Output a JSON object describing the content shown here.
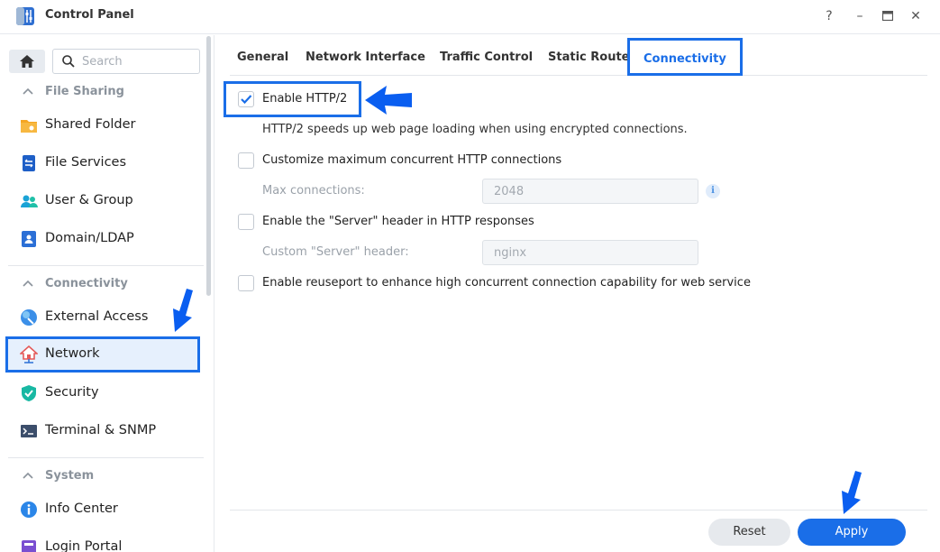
{
  "window": {
    "title": "Control Panel",
    "controls": [
      "?",
      "–",
      "□",
      "✕"
    ]
  },
  "sidebar": {
    "search_placeholder": "Search",
    "sections": [
      {
        "label": "File Sharing",
        "items": [
          "Shared Folder",
          "File Services",
          "User & Group",
          "Domain/LDAP"
        ]
      },
      {
        "label": "Connectivity",
        "items": [
          "External Access",
          "Network",
          "Security",
          "Terminal & SNMP"
        ]
      },
      {
        "label": "System",
        "items": [
          "Info Center",
          "Login Portal"
        ]
      }
    ],
    "selected_item": "Network"
  },
  "tabs": [
    "General",
    "Network Interface",
    "Traffic Control",
    "Static Route",
    "Connectivity"
  ],
  "active_tab": "Connectivity",
  "content": {
    "enable_http2": {
      "label": "Enable HTTP/2",
      "checked": true
    },
    "http2_hint": "HTTP/2 speeds up web page loading when using encrypted connections.",
    "max_connections_option": {
      "label": "Customize maximum concurrent HTTP connections",
      "checked": false
    },
    "max_connections": {
      "label": "Max connections:",
      "value": "2048"
    },
    "server_header_option": {
      "label": "Enable the \"Server\" header in HTTP responses",
      "checked": false
    },
    "server_header": {
      "label": "Custom \"Server\" header:",
      "value": "nginx"
    },
    "reuseport_option": {
      "label": "Enable reuseport to enhance high concurrent connection capability for web service",
      "checked": false
    }
  },
  "buttons": {
    "reset": "Reset",
    "apply": "Apply"
  },
  "colors": {
    "accent": "#1a6ee8",
    "highlight_blue": "#0a5ef0"
  }
}
